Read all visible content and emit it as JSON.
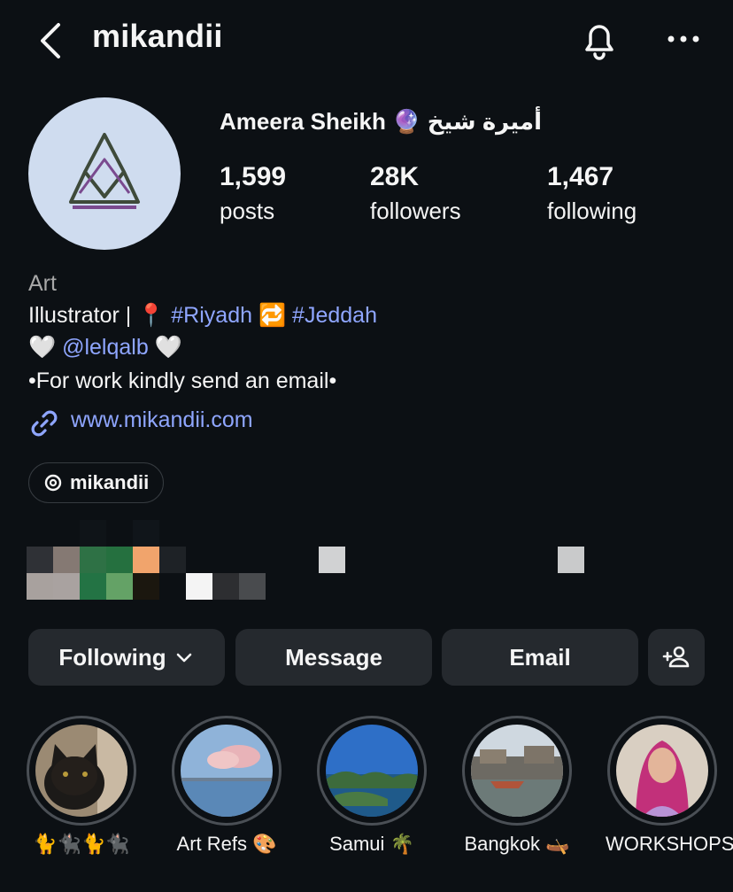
{
  "header": {
    "handle": "mikandii"
  },
  "profile": {
    "display_name": "Ameera Sheikh 🔮 أميرة شيخ",
    "stats": [
      {
        "value": "1,599",
        "label": "posts"
      },
      {
        "value": "28K",
        "label": "followers"
      },
      {
        "value": "1,467",
        "label": "following"
      }
    ],
    "category": "Art",
    "bio": {
      "line1_prefix": "Illustrator | 📍 ",
      "line1_tag1": "#Riyadh",
      "line1_mid": " 🔁 ",
      "line1_tag2": "#Jeddah",
      "line2_pre": "🤍 ",
      "line2_mention": "@lelqalb",
      "line2_post": " 🤍",
      "line3": "•For work kindly send an email•"
    },
    "website": "www.mikandii.com",
    "threads_label": "mikandii"
  },
  "actions": {
    "following_label": "Following",
    "message_label": "Message",
    "email_label": "Email"
  },
  "highlights": [
    {
      "label": "🐈🐈‍⬛🐈🐈‍⬛"
    },
    {
      "label": "Art Refs 🎨"
    },
    {
      "label": "Samui 🌴"
    },
    {
      "label": "Bangkok 🛶"
    },
    {
      "label": "WORKSHOPS"
    }
  ],
  "colors": {
    "background": "#0c1014",
    "button": "#25292e",
    "link": "#8fa6ff",
    "muted": "#a8a8a8"
  }
}
